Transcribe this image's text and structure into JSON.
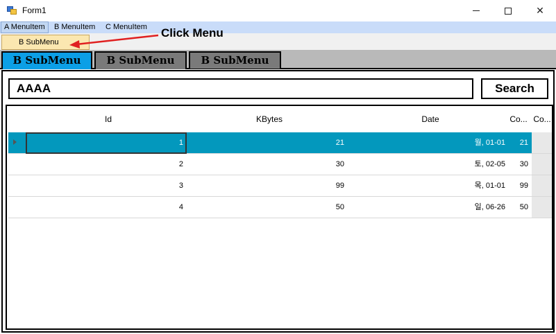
{
  "window": {
    "title": "Form1"
  },
  "menubar": {
    "items": [
      "A MenuItem",
      "B MenuItem",
      "C MenuItem"
    ]
  },
  "dropdown": {
    "items": [
      "B SubMenu"
    ]
  },
  "annotation": {
    "text": "Click Menu"
  },
  "tabs": [
    "B SubMenu",
    "B SubMenu",
    "B SubMenu"
  ],
  "search": {
    "value": "AAAA",
    "button_label": "Search"
  },
  "grid": {
    "columns": [
      "Id",
      "KBytes",
      "Date",
      "Co...",
      "Co..."
    ],
    "rows": [
      {
        "id": "1",
        "kbytes": "21",
        "date": "월, 01-01",
        "co": "21"
      },
      {
        "id": "2",
        "kbytes": "30",
        "date": "토, 02-05",
        "co": "30"
      },
      {
        "id": "3",
        "kbytes": "99",
        "date": "목, 01-01",
        "co": "99"
      },
      {
        "id": "4",
        "kbytes": "50",
        "date": "일, 06-26",
        "co": "50"
      }
    ]
  },
  "colors": {
    "selected_row": "#0398bd",
    "active_tab": "#0c9fe6",
    "inactive_tab": "#7a7a7a",
    "annotation_arrow": "#e02020"
  }
}
